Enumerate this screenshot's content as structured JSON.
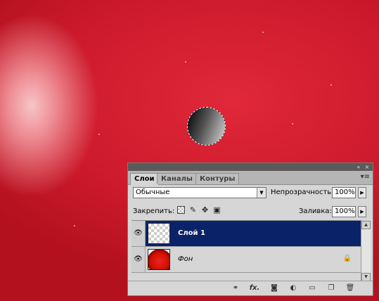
{
  "canvas": {
    "accent_color": "#cd1a2c",
    "highlight_color": "#f6c6c8"
  },
  "layers_panel": {
    "tabs": [
      {
        "label": "Слои",
        "active": true
      },
      {
        "label": "Каналы",
        "active": false
      },
      {
        "label": "Контуры",
        "active": false
      }
    ],
    "titlebar": {
      "collapse_icon": "«",
      "close_icon": "×",
      "menu_icon": "▾≡"
    },
    "blend_mode": "Обычные",
    "opacity_label": "Непрозрачность:",
    "opacity_value": "100%",
    "lock_label": "Закрепить:",
    "lock_icons": [
      "lock-transparent-icon",
      "lock-brush-icon",
      "lock-move-icon",
      "lock-all-icon"
    ],
    "fill_label": "Заливка:",
    "fill_value": "100%",
    "selected_color": "#0a2267",
    "layers": [
      {
        "name": "Слой 1",
        "selected": true,
        "visible": true,
        "thumbnail": "transparent"
      },
      {
        "name": "Фон",
        "selected": false,
        "visible": true,
        "thumbnail": "apple",
        "locked": true
      }
    ],
    "footer_icons": [
      "link-layers-icon",
      "fx-icon",
      "add-mask-icon",
      "adjustment-layer-icon",
      "new-group-icon",
      "new-layer-icon",
      "delete-layer-icon"
    ],
    "footer_fx_label": "fx."
  }
}
